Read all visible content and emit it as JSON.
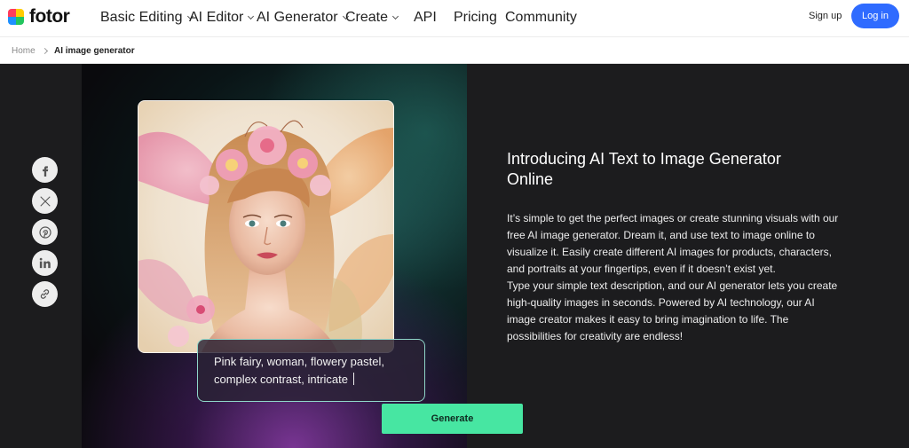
{
  "brand": {
    "name": "fotor"
  },
  "nav": {
    "items": [
      {
        "label": "Basic Editing",
        "dropdown": true
      },
      {
        "label": "AI Editor",
        "dropdown": true
      },
      {
        "label": "AI Generator",
        "dropdown": true
      },
      {
        "label": "Create",
        "dropdown": true
      },
      {
        "label": "API",
        "dropdown": false
      },
      {
        "label": "Pricing",
        "dropdown": false
      },
      {
        "label": "Community",
        "dropdown": false
      }
    ],
    "signup": "Sign up",
    "login": "Log in"
  },
  "breadcrumb": {
    "home": "Home",
    "current": "AI image generator"
  },
  "hero": {
    "prompt_line1": "Pink fairy, woman, flowery pastel,",
    "prompt_line2": "complex contrast, intricate",
    "generate": "Generate",
    "headline_line1": "Introducing AI Text to Image Generator",
    "headline_line2": "Online",
    "paragraph1": "It’s simple to get the perfect images or create stunning visuals with our free AI image generator. Dream it, and use text to image online to visualize it. Easily create different AI images for products, characters, and portraits at your fingertips, even if it doesn’t exist yet.",
    "paragraph2": "Type your simple text description, and our AI generator lets you create high-quality images in seconds. Powered by AI technology, our AI image creator makes it easy to bring imagination to life. The possibilities for creativity are endless!"
  },
  "social": [
    "facebook-icon",
    "x-icon",
    "pinterest-icon",
    "linkedin-icon",
    "link-icon"
  ],
  "colors": {
    "accent": "#2f6bff",
    "generate": "#47e6a2",
    "hero_bg": "#1c1c1e"
  }
}
